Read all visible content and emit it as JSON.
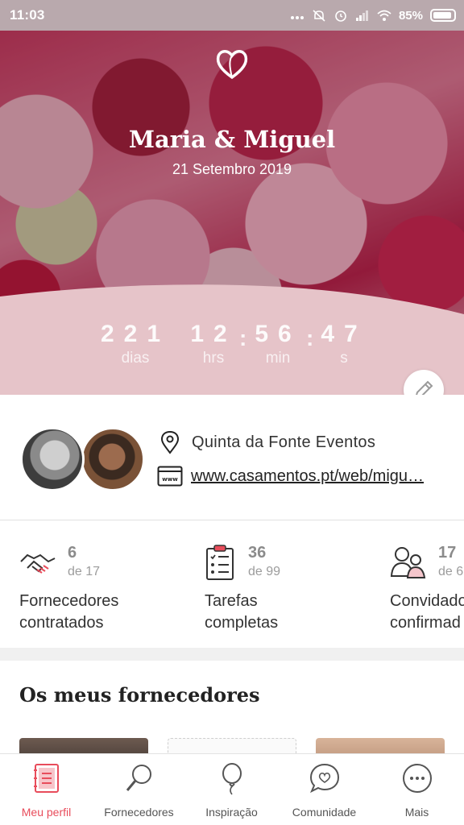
{
  "status_bar": {
    "time": "11:03",
    "battery": "85%",
    "icons": [
      "more-dots-icon",
      "mute-icon",
      "alarm-icon",
      "signal-icon",
      "wifi-icon",
      "battery-icon"
    ]
  },
  "hero": {
    "names": "Maria & Miguel",
    "date": "21 Setembro 2019",
    "countdown": {
      "days": "221",
      "hours": "12",
      "minutes": "56",
      "seconds": "47",
      "days_label": "dias",
      "hours_label": "hrs",
      "minutes_label": "min",
      "seconds_label": "s",
      "separator": ":"
    }
  },
  "info": {
    "venue": "Quinta da Fonte Eventos",
    "website": "www.casamentos.pt/web/migu…"
  },
  "stats": [
    {
      "count": "6",
      "total": "de 17",
      "label_line1": "Fornecedores",
      "label_line2": "contratados",
      "icon": "handshake-icon"
    },
    {
      "count": "36",
      "total": "de 99",
      "label_line1": "Tarefas",
      "label_line2": "completas",
      "icon": "checklist-icon"
    },
    {
      "count": "17",
      "total": "de 6",
      "label_line1": "Convidado",
      "label_line2": "confirmad",
      "icon": "guests-icon"
    }
  ],
  "vendors": {
    "title": "Os meus fornecedores"
  },
  "bottom_nav": [
    {
      "label": "Meu perfil",
      "icon": "notebook-icon",
      "active": true
    },
    {
      "label": "Fornecedores",
      "icon": "search-icon",
      "active": false
    },
    {
      "label": "Inspiração",
      "icon": "balloon-icon",
      "active": false
    },
    {
      "label": "Comunidade",
      "icon": "chat-heart-icon",
      "active": false
    },
    {
      "label": "Mais",
      "icon": "more-icon",
      "active": false
    }
  ],
  "colors": {
    "accent": "#e84c5b",
    "wave": "#e6c4c9",
    "status_bar": "#b9a9ad"
  }
}
